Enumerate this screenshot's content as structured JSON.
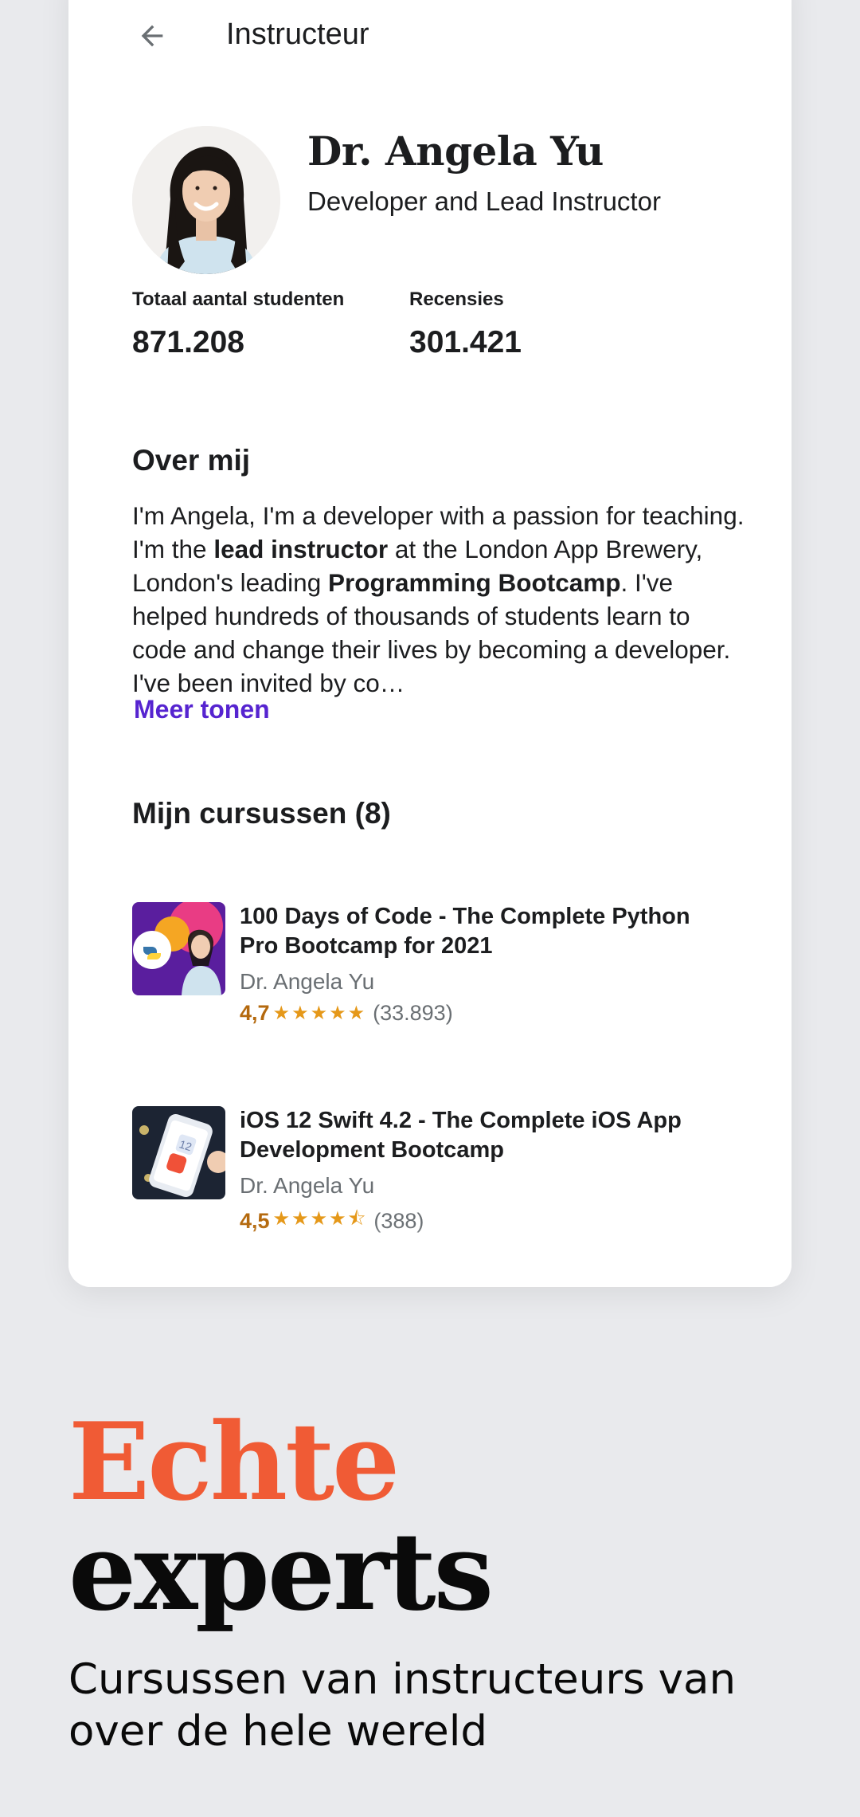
{
  "topbar": {
    "title": "Instructeur",
    "back_icon": "arrow-left-icon"
  },
  "profile": {
    "name": "Dr. Angela Yu",
    "headline": "Developer and Lead Instructor"
  },
  "stats": {
    "students_label": "Totaal aantal studenten",
    "students_value": "871.208",
    "reviews_label": "Recensies",
    "reviews_value": "301.421"
  },
  "about": {
    "title": "Over mij",
    "p1": "I'm Angela, I'm a developer with a passion for teaching. I'm the ",
    "b1": "lead instructor",
    "p2": " at the London App Brewery, London's leading ",
    "b2": "Programming Bootcamp",
    "p3": ". I've helped hundreds of thousands of students learn to code and change their lives by becoming a developer. I've been invited by co…",
    "more": "Meer tonen"
  },
  "courses": {
    "title": "Mijn cursussen (8)",
    "items": [
      {
        "title": "100 Days of Code - The Complete Python Pro Bootcamp for 2021",
        "author": "Dr. Angela Yu",
        "rating": "4,7",
        "stars": "★★★★★",
        "count": "(33.893)"
      },
      {
        "title": "iOS 12 Swift 4.2 - The Complete iOS App Development Bootcamp",
        "author": "Dr. Angela Yu",
        "rating": "4,5",
        "stars": "★★★★⯪",
        "count": "(388)"
      }
    ]
  },
  "promo": {
    "line1": "Echte",
    "line2": "experts",
    "subtitle": "Cursussen van instructeurs van over de hele wereld"
  },
  "colors": {
    "accent": "#f05b35",
    "link": "#5624d0",
    "rating": "#b4690e",
    "star": "#e59819",
    "background": "#e9eaed"
  }
}
